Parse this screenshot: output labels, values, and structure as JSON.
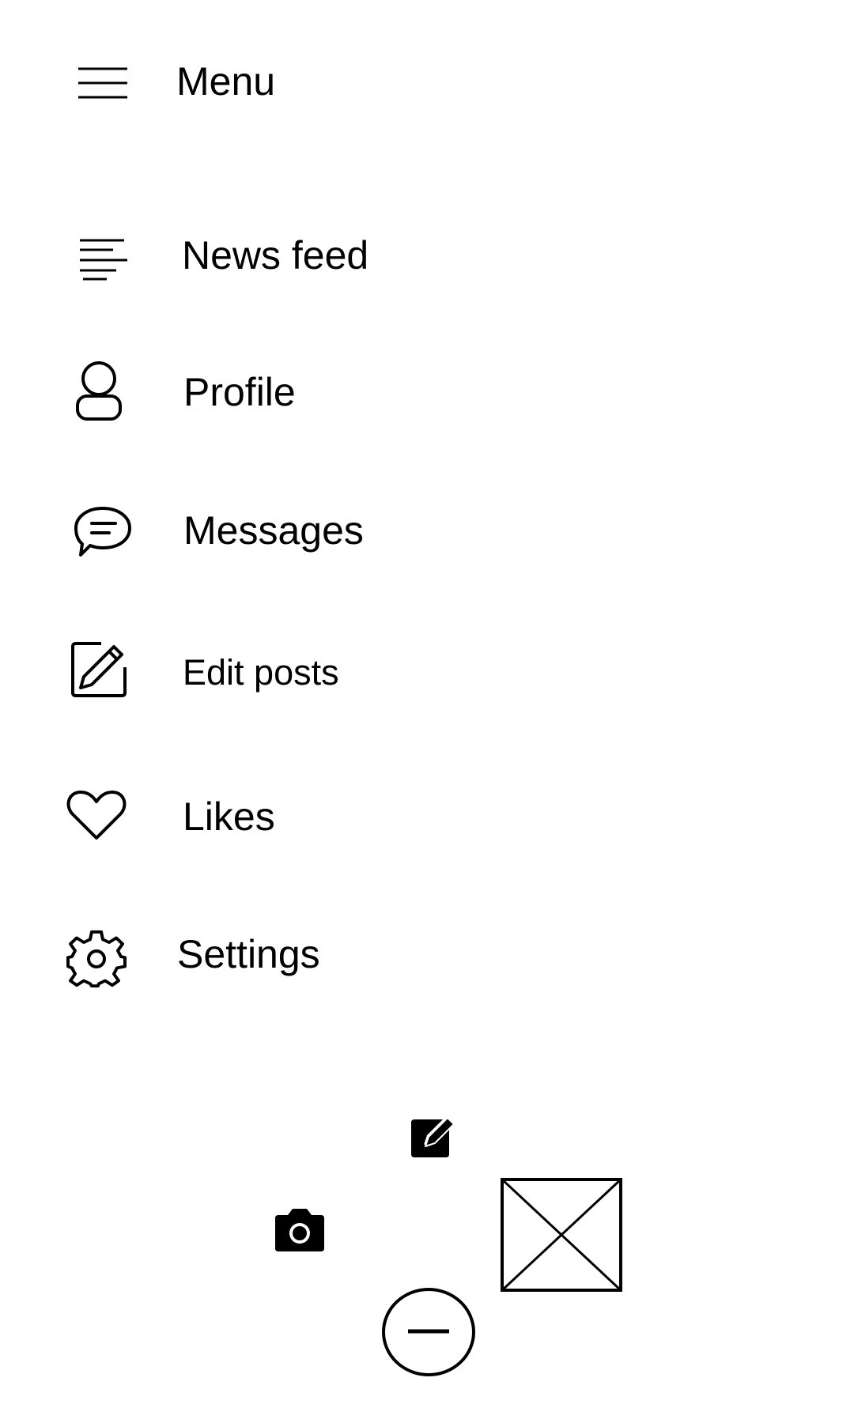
{
  "header": {
    "title": "Menu",
    "menu_icon": "hamburger-icon"
  },
  "menu": {
    "items": [
      {
        "label": "News feed",
        "icon": "news-feed-icon"
      },
      {
        "label": "Profile",
        "icon": "person-icon"
      },
      {
        "label": "Messages",
        "icon": "chat-bubble-icon"
      },
      {
        "label": "Edit posts",
        "icon": "edit-square-icon"
      },
      {
        "label": "Likes",
        "icon": "heart-icon"
      },
      {
        "label": "Settings",
        "icon": "gear-icon"
      }
    ]
  },
  "actions": {
    "compose_icon": "compose-icon",
    "camera_icon": "camera-icon",
    "image_placeholder_icon": "image-placeholder-icon",
    "collapse_icon": "minus-circle-icon"
  }
}
